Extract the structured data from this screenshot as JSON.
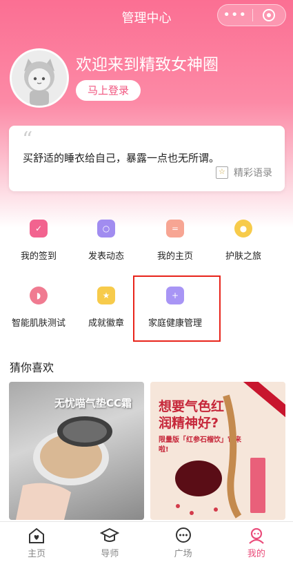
{
  "nav": {
    "title": "管理中心",
    "menu_dots": "•••",
    "menu_icon": "more-dots-icon",
    "close_icon": "target-circle-icon"
  },
  "profile": {
    "welcome": "欢迎来到精致女神圈",
    "login_label": "马上登录",
    "avatar_icon": "cat-avatar-icon"
  },
  "quote": {
    "mark": "“",
    "text": "买舒适的睡衣给自己，暴露一点也无所谓。",
    "link_label": "精彩语录",
    "link_icon": "book-star-icon"
  },
  "grid": [
    {
      "label": "我的签到",
      "icon": "checkin-icon",
      "color": "#f2638f"
    },
    {
      "label": "发表动态",
      "icon": "post-icon",
      "color": "#a18cf0"
    },
    {
      "label": "我的主页",
      "icon": "homepage-icon",
      "color": "#f7a593"
    },
    {
      "label": "护肤之旅",
      "icon": "bulb-icon",
      "color": "#f7cb4b"
    },
    {
      "label": "智能肌肤测试",
      "icon": "face-icon",
      "color": "#f07b91"
    },
    {
      "label": "成就徽章",
      "icon": "badge-icon",
      "color": "#f7cb4b"
    },
    {
      "label": "家庭健康管理",
      "icon": "medical-kit-icon",
      "color": "#a895f5"
    }
  ],
  "section": {
    "title": "猜你喜欢"
  },
  "products": [
    {
      "headline": "无忧喵气垫CC霜"
    },
    {
      "headline": "想要气色红润精神好?",
      "subline": "限量版「红参石榴饮」它来啦!"
    }
  ],
  "tabs": [
    {
      "label": "主页",
      "icon": "home-heart-icon",
      "active": false
    },
    {
      "label": "导师",
      "icon": "graduation-cap-icon",
      "active": false
    },
    {
      "label": "广场",
      "icon": "chat-bubble-icon",
      "active": false
    },
    {
      "label": "我的",
      "icon": "user-icon",
      "active": true
    }
  ],
  "colors": {
    "brand_pink": "#fb6f93",
    "active_tab": "#ea4c7a",
    "highlight": "#e8231a"
  }
}
